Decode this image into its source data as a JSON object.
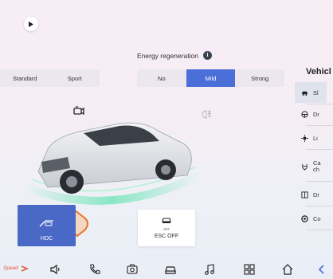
{
  "top": {
    "play_icon": "play-icon"
  },
  "drive_mode": {
    "options": [
      "Standard",
      "Sport"
    ]
  },
  "energy_regeneration": {
    "label": "Energy regeneration",
    "info_icon": "i",
    "options": [
      "No",
      "Mild",
      "Strong"
    ],
    "selected": "Mild"
  },
  "side_panel": {
    "title": "Vehicl",
    "items": [
      {
        "label": "Sl",
        "icon": "car-icon",
        "active": true
      },
      {
        "label": "Dr",
        "icon": "steering-wheel-icon",
        "active": false
      },
      {
        "label": "Li",
        "icon": "sun-icon",
        "active": false
      },
      {
        "label": "Ca ch",
        "icon": "charging-icon",
        "active": false
      },
      {
        "label": "Dr",
        "icon": "door-icon",
        "active": false
      },
      {
        "label": "Co",
        "icon": "tire-icon",
        "active": false
      }
    ]
  },
  "controls": {
    "hdc_label": "HDC",
    "esc_label": "ESC OFF",
    "esc_badge": "OFF"
  },
  "bottom_nav": {
    "speed_label": "Speed",
    "items": [
      "volume-icon",
      "phone-icon",
      "camera-360-icon",
      "car-icon",
      "music-icon",
      "apps-grid-icon",
      "home-icon",
      "back-icon"
    ]
  },
  "colors": {
    "accent": "#4b6fd8",
    "hdc_bg": "#4a69c7",
    "gesture": "#e8742e"
  }
}
